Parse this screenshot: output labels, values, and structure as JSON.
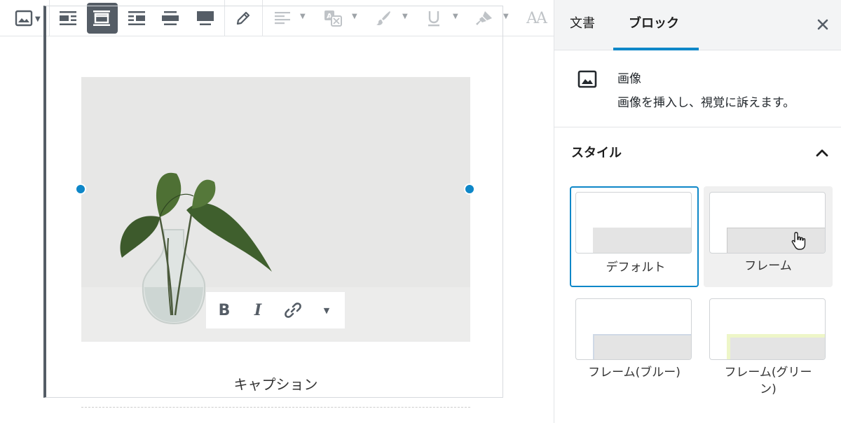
{
  "toolbar": {
    "items": [
      {
        "id": "image-type",
        "icon": "image-icon"
      },
      {
        "id": "align-left",
        "icon": "align-left-icon"
      },
      {
        "id": "align-center",
        "icon": "align-center-icon"
      },
      {
        "id": "align-right",
        "icon": "align-right-icon"
      },
      {
        "id": "wide-width",
        "icon": "wide-width-icon"
      },
      {
        "id": "full-width",
        "icon": "full-width-icon"
      },
      {
        "id": "edit",
        "icon": "pencil-icon"
      },
      {
        "id": "text-align",
        "icon": "text-align-icon"
      },
      {
        "id": "translate",
        "icon": "translate-icon"
      },
      {
        "id": "brush",
        "icon": "brush-icon"
      },
      {
        "id": "underline",
        "icon": "underline-icon"
      },
      {
        "id": "highlighter",
        "icon": "highlighter-icon"
      },
      {
        "id": "font-size",
        "icon": "font-size-icon",
        "label": "AA"
      }
    ]
  },
  "editor": {
    "caption": "キャプション",
    "inline_toolbar": {
      "bold": "B",
      "italic": "I",
      "link_icon": "link-icon",
      "more_icon": "chevron-down-icon"
    }
  },
  "sidebar": {
    "tabs": [
      {
        "label": "文書",
        "active": false
      },
      {
        "label": "ブロック",
        "active": true
      }
    ],
    "close_icon": "close-icon",
    "block": {
      "icon": "image-icon",
      "title": "画像",
      "description": "画像を挿入し、視覚に訴えます。"
    },
    "styles_panel": {
      "title": "スタイル",
      "toggle_icon": "chevron-up-icon",
      "items": [
        {
          "label": "デフォルト",
          "selected": true
        },
        {
          "label": "フレーム",
          "selected": false
        },
        {
          "label": "フレーム(ブルー)",
          "selected": false
        },
        {
          "label_line1": "フレーム(グリー",
          "label_line2": "ン)",
          "selected": false
        }
      ]
    }
  },
  "colors": {
    "accent": "#0e87c8",
    "toolbar_active": "#555d66",
    "frame_green": "#eef6c8"
  }
}
